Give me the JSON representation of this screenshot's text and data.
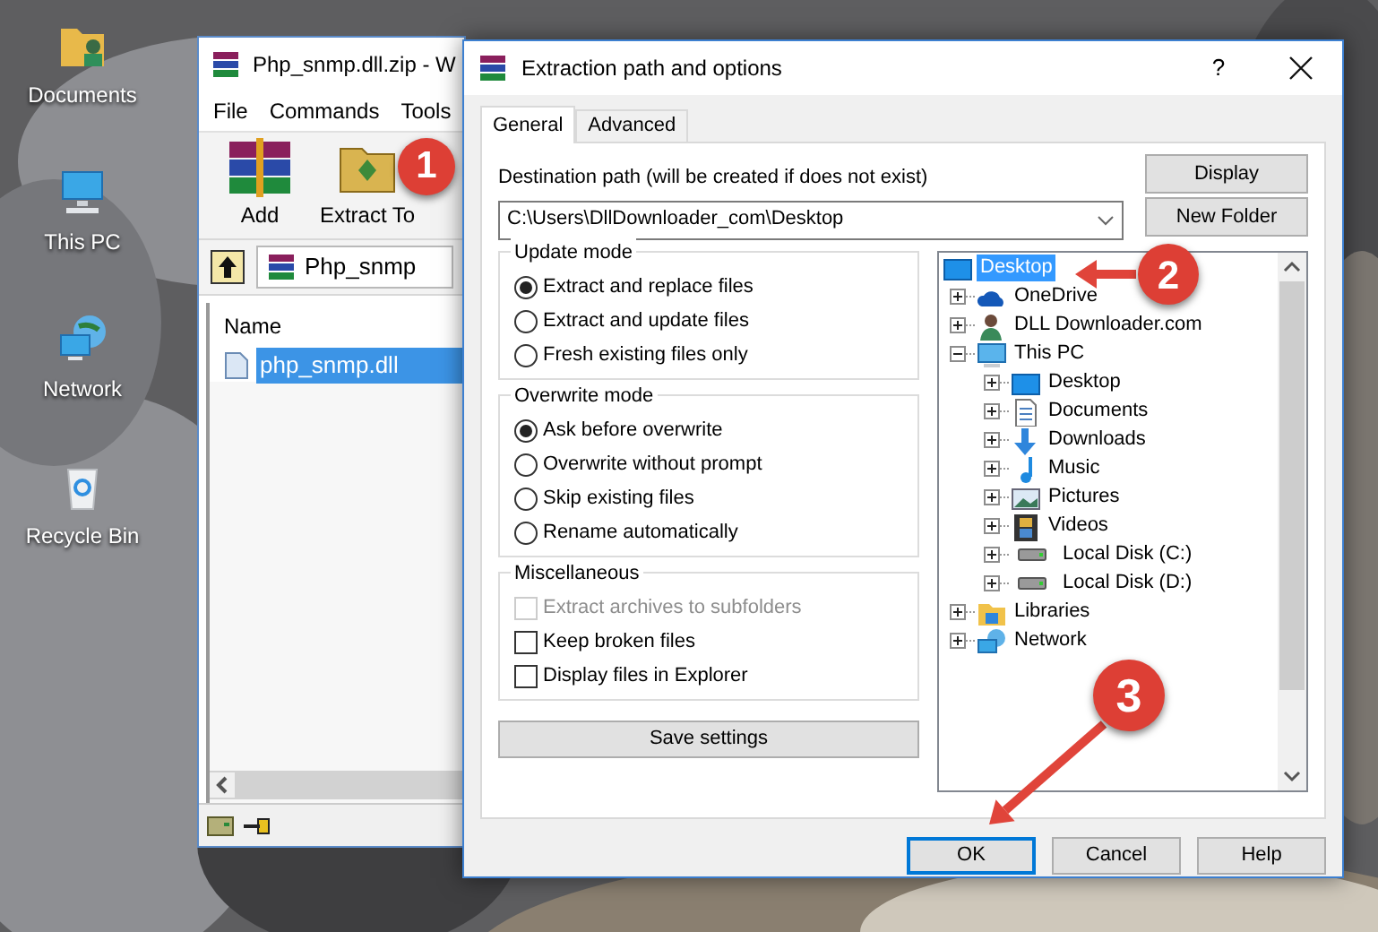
{
  "desktop_icons": [
    {
      "kind": "documents",
      "label": "Documents"
    },
    {
      "kind": "pc",
      "label": "This PC"
    },
    {
      "kind": "network",
      "label": "Network"
    },
    {
      "kind": "recycle",
      "label": "Recycle Bin"
    }
  ],
  "archive_window": {
    "title": "Php_snmp.dll.zip - W",
    "menu": [
      "File",
      "Commands",
      "Tools"
    ],
    "toolbar": [
      {
        "kind": "add",
        "label": "Add"
      },
      {
        "kind": "extract",
        "label": "Extract To"
      }
    ],
    "address": "Php_snmp",
    "columns": [
      "Name"
    ],
    "files": [
      {
        "name": "php_snmp.dll",
        "selected": true
      }
    ]
  },
  "dialog": {
    "title": "Extraction path and options",
    "help": "?",
    "tabs": [
      {
        "label": "General",
        "selected": true
      },
      {
        "label": "Advanced",
        "selected": false
      }
    ],
    "destination_label": "Destination path (will be created if does not exist)",
    "destination": "C:\\Users\\DllDownloader_com\\Desktop",
    "side_buttons": [
      "Display",
      "New Folder"
    ],
    "groups": [
      {
        "kind": "radio",
        "title": "Update mode",
        "options": [
          {
            "label": "Extract and replace files",
            "selected": true
          },
          {
            "label": "Extract and update files",
            "selected": false
          },
          {
            "label": "Fresh existing files only",
            "selected": false
          }
        ]
      },
      {
        "kind": "radio",
        "title": "Overwrite mode",
        "options": [
          {
            "label": "Ask before overwrite",
            "selected": true
          },
          {
            "label": "Overwrite without prompt",
            "selected": false
          },
          {
            "label": "Skip existing files",
            "selected": false
          },
          {
            "label": "Rename automatically",
            "selected": false
          }
        ]
      },
      {
        "kind": "checkbox",
        "title": "Miscellaneous",
        "options": [
          {
            "label": "Extract archives to subfolders",
            "checked": false,
            "disabled": true
          },
          {
            "label": "Keep broken files",
            "checked": false,
            "disabled": false
          },
          {
            "label": "Display files in Explorer",
            "checked": false,
            "disabled": false
          }
        ]
      }
    ],
    "save_button": "Save settings",
    "tree": [
      {
        "kind": "desktop",
        "label": "Desktop",
        "selected": true,
        "children": [
          {
            "kind": "cloud",
            "label": "OneDrive",
            "selected": false,
            "expanded": false
          },
          {
            "kind": "user",
            "label": "DLL Downloader.com",
            "selected": false,
            "expanded": false
          },
          {
            "kind": "pc",
            "label": "This PC",
            "selected": false,
            "expanded": true,
            "children": [
              {
                "kind": "desktop",
                "label": "Desktop",
                "selected": false,
                "expanded": false
              },
              {
                "kind": "documents",
                "label": "Documents",
                "selected": false,
                "expanded": false
              },
              {
                "kind": "downloads",
                "label": "Downloads",
                "selected": false,
                "expanded": false
              },
              {
                "kind": "music",
                "label": "Music",
                "selected": false,
                "expanded": false
              },
              {
                "kind": "pictures",
                "label": "Pictures",
                "selected": false,
                "expanded": false
              },
              {
                "kind": "videos",
                "label": "Videos",
                "selected": false,
                "expanded": false
              },
              {
                "kind": "disk",
                "label": "Local Disk (C:)",
                "selected": false,
                "expanded": false
              },
              {
                "kind": "disk",
                "label": "Local Disk (D:)",
                "selected": false,
                "expanded": false
              }
            ]
          },
          {
            "kind": "libraries",
            "label": "Libraries",
            "selected": false,
            "expanded": false
          },
          {
            "kind": "network",
            "label": "Network",
            "selected": false,
            "expanded": false
          }
        ]
      }
    ],
    "buttons": [
      {
        "label": "OK",
        "default": true
      },
      {
        "label": "Cancel",
        "default": false
      },
      {
        "label": "Help",
        "default": false
      }
    ]
  },
  "annotations": [
    {
      "label": "1"
    },
    {
      "label": "2"
    },
    {
      "label": "3"
    }
  ]
}
